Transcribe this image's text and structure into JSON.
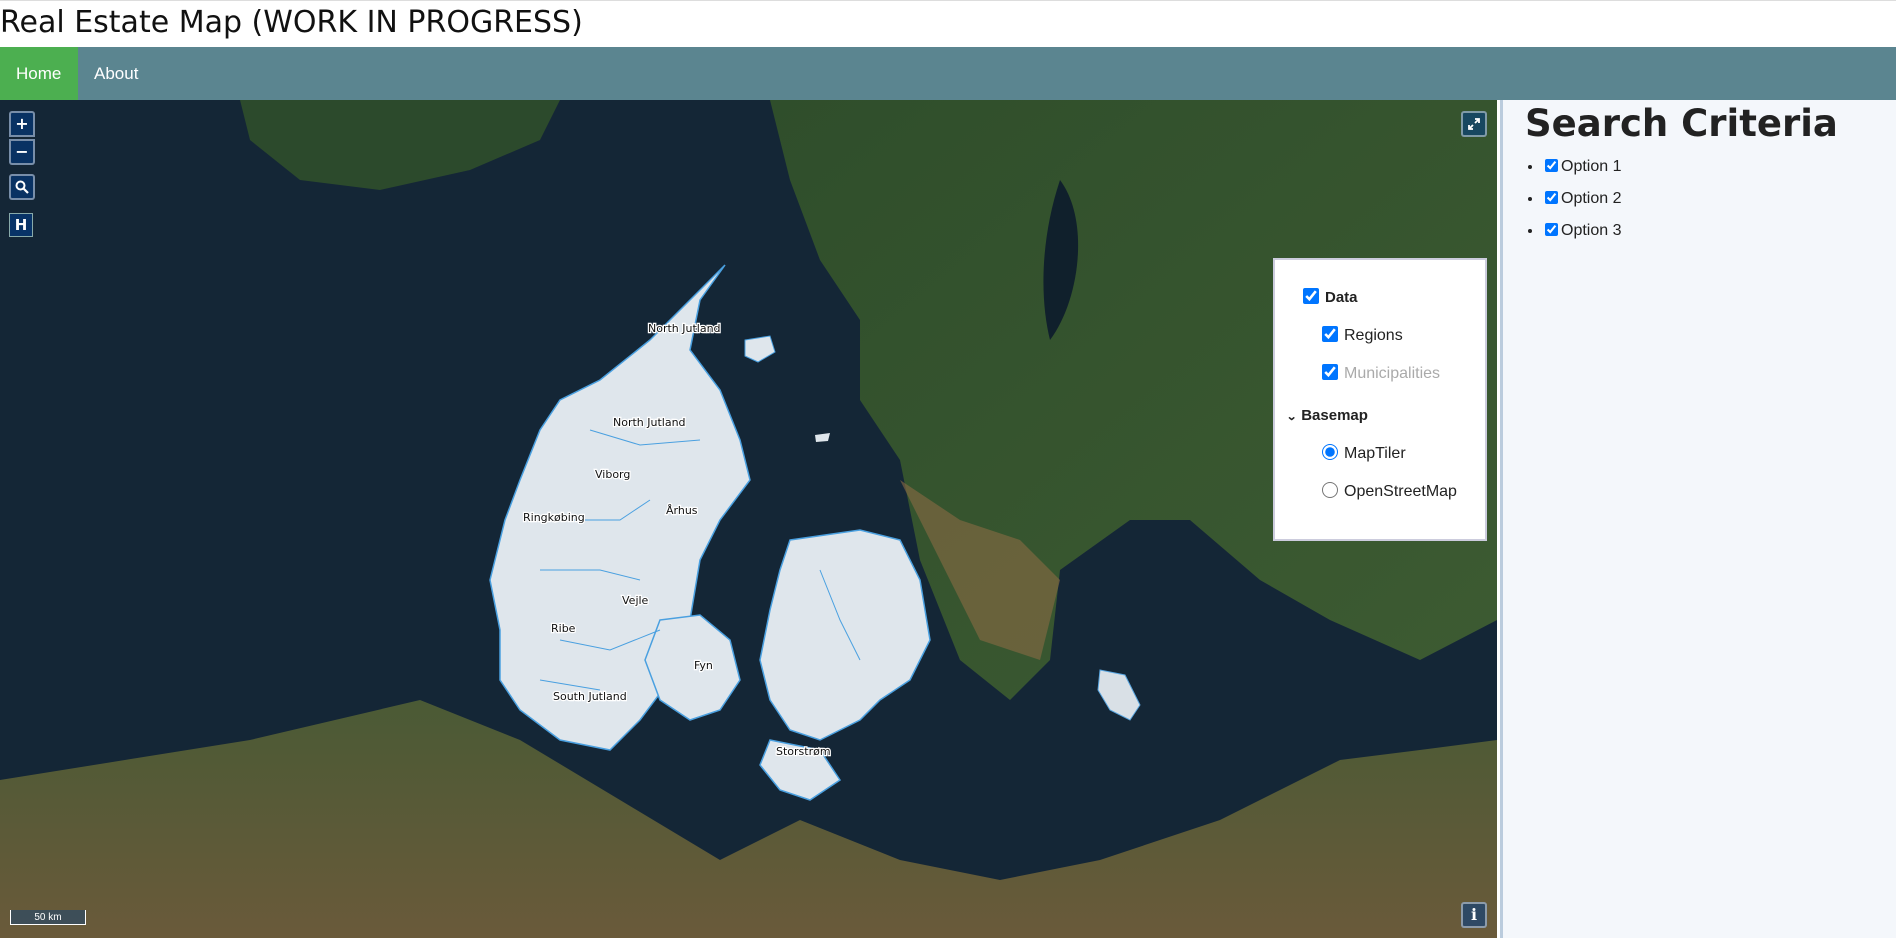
{
  "app": {
    "title": "Real Estate Map (WORK IN PROGRESS)"
  },
  "nav": {
    "items": [
      {
        "label": "Home",
        "active": true
      },
      {
        "label": "About",
        "active": false
      }
    ]
  },
  "map": {
    "controls": {
      "zoom_in": "+",
      "zoom_out": "−",
      "search_icon": "search-icon",
      "h_label": "H",
      "fullscreen_icon": "fullscreen-icon",
      "info_label": "i"
    },
    "scale": "50 km",
    "region_labels": [
      "North Jutland",
      "North Jutland",
      "Viborg",
      "Ringkøbing",
      "Århus",
      "Vejle",
      "Ribe",
      "Fyn",
      "South Jutland",
      "Storstrøm"
    ],
    "layer_panel": {
      "data_group": {
        "label": "Data",
        "checked": true
      },
      "regions": {
        "label": "Regions",
        "checked": true
      },
      "municipalities": {
        "label": "Municipalities",
        "checked": true
      },
      "basemap_group": {
        "label": "Basemap"
      },
      "basemaps": [
        {
          "label": "MapTiler",
          "selected": true
        },
        {
          "label": "OpenStreetMap",
          "selected": false
        }
      ]
    },
    "colors": {
      "sea": "#152838",
      "land": "#3a5a30",
      "region_fill": "#dfe6ec",
      "region_border": "#4aa0e0"
    }
  },
  "sidebar": {
    "title": "Search Criteria",
    "options": [
      {
        "label": "Option 1",
        "checked": true
      },
      {
        "label": "Option 2",
        "checked": true
      },
      {
        "label": "Option 3",
        "checked": true
      }
    ]
  }
}
